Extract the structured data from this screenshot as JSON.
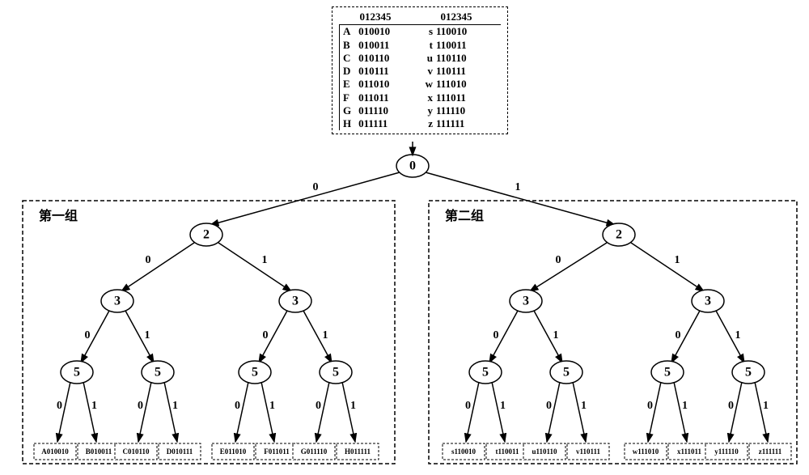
{
  "table": {
    "header_left": "012345",
    "header_right": "012345",
    "rows_left": [
      {
        "k": "A",
        "v": "010010"
      },
      {
        "k": "B",
        "v": "010011"
      },
      {
        "k": "C",
        "v": "010110"
      },
      {
        "k": "D",
        "v": "010111"
      },
      {
        "k": "E",
        "v": "011010"
      },
      {
        "k": "F",
        "v": "011011"
      },
      {
        "k": "G",
        "v": "011110"
      },
      {
        "k": "H",
        "v": "011111"
      }
    ],
    "rows_right": [
      {
        "k": "s",
        "v": "110010"
      },
      {
        "k": "t",
        "v": "110011"
      },
      {
        "k": "u",
        "v": "110110"
      },
      {
        "k": "v",
        "v": "110111"
      },
      {
        "k": "w",
        "v": "111010"
      },
      {
        "k": "x",
        "v": "111011"
      },
      {
        "k": "y",
        "v": "111110"
      },
      {
        "k": "z",
        "v": "111111"
      }
    ]
  },
  "groups": {
    "g1_label": "第一组",
    "g2_label": "第二组"
  },
  "tree": {
    "root": "0",
    "level1": [
      "2",
      "2"
    ],
    "level2": [
      "3",
      "3",
      "3",
      "3"
    ],
    "level3": [
      "5",
      "5",
      "5",
      "5",
      "5",
      "5",
      "5",
      "5"
    ],
    "edge_labels": {
      "zero": "0",
      "one": "1"
    }
  },
  "leaves": {
    "g1": [
      "A010010",
      "B010011",
      "C010110",
      "D010111",
      "E011010",
      "F011011",
      "G011110",
      "H011111"
    ],
    "g2": [
      "s110010",
      "t110011",
      "u110110",
      "v110111",
      "w111010",
      "x111011",
      "y111110",
      "z111111"
    ]
  }
}
